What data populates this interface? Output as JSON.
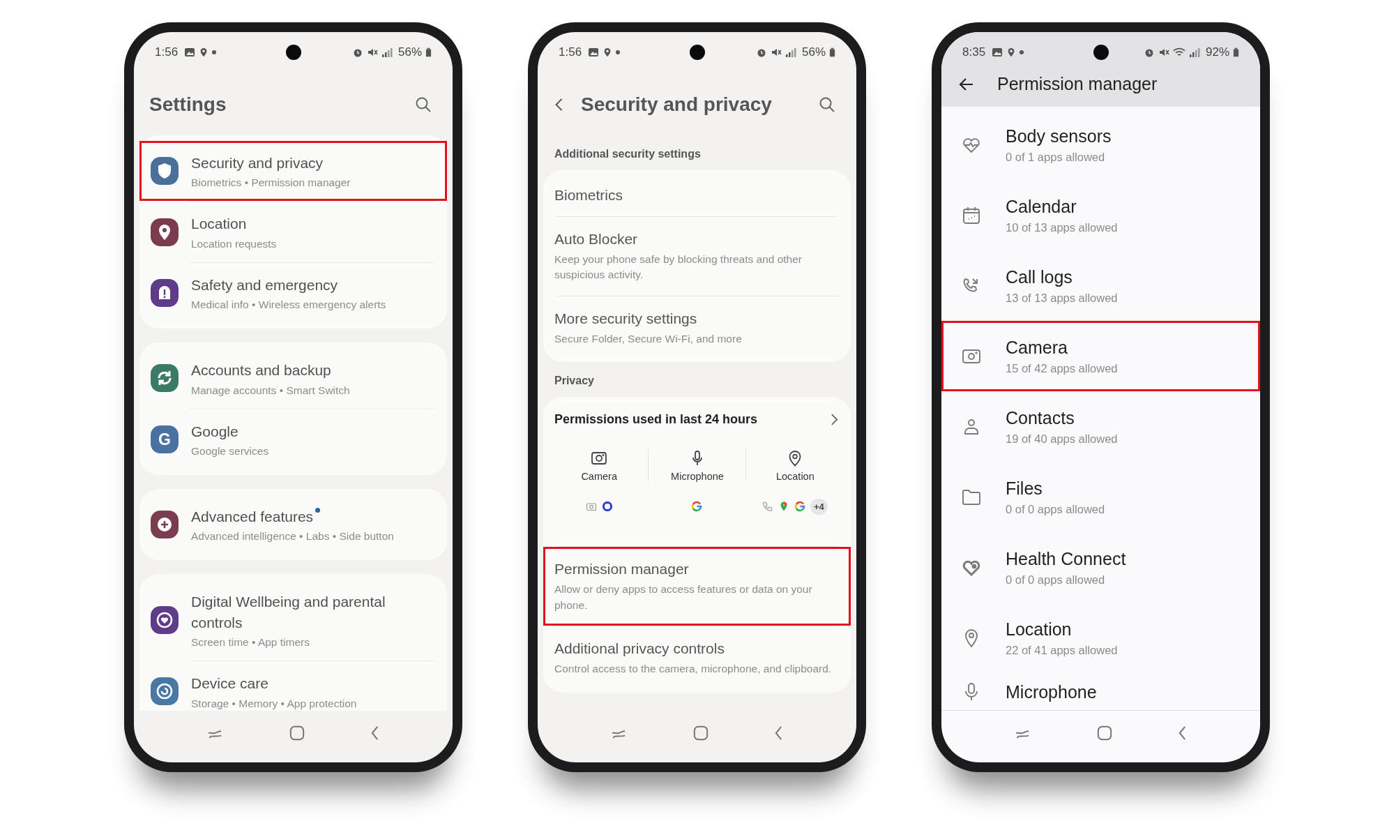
{
  "phones": [
    {
      "kind": "settings",
      "status_bar": {
        "time": "1:56",
        "battery": "56%"
      },
      "header": {
        "title": "Settings",
        "search": true
      },
      "groups": [
        {
          "items": [
            {
              "kind": "shield",
              "color": "#4a6f9a",
              "title": "Security and privacy",
              "subtitle": "Biometrics • Permission manager",
              "highlighted": true,
              "badge": false
            },
            {
              "kind": "pin",
              "color": "#7a3c4e",
              "title": "Location",
              "subtitle": "Location requests",
              "highlighted": false,
              "badge": false
            },
            {
              "kind": "alert",
              "color": "#5e3c8a",
              "title": "Safety and emergency",
              "subtitle": "Medical info • Wireless emergency alerts",
              "highlighted": false,
              "badge": false
            }
          ]
        },
        {
          "items": [
            {
              "kind": "sync",
              "color": "#3c7a68",
              "title": "Accounts and backup",
              "subtitle": "Manage accounts • Smart Switch",
              "highlighted": false,
              "badge": false
            },
            {
              "kind": "letter",
              "icon_text": "G",
              "color": "#4a72a0",
              "title": "Google",
              "subtitle": "Google services",
              "highlighted": false,
              "badge": false
            }
          ]
        },
        {
          "items": [
            {
              "kind": "gear",
              "color": "#7a3c4e",
              "title": "Advanced features",
              "subtitle": "Advanced intelligence • Labs • Side button",
              "highlighted": false,
              "badge": true
            }
          ]
        },
        {
          "items": [
            {
              "kind": "heart",
              "color": "#5e3c8a",
              "title": "Digital Wellbeing and parental controls",
              "subtitle": "Screen time • App timers",
              "highlighted": false,
              "badge": false
            },
            {
              "kind": "care",
              "color": "#4a78a5",
              "title": "Device care",
              "subtitle": "Storage • Memory • App protection",
              "highlighted": false,
              "badge": false
            }
          ]
        }
      ]
    },
    {
      "kind": "security",
      "status_bar": {
        "time": "1:56",
        "battery": "56%"
      },
      "header": {
        "title": "Security and privacy",
        "back": true,
        "search": true
      },
      "sections": [
        {
          "label": "Additional security settings",
          "items": [
            {
              "kind": "item",
              "title": "Biometrics",
              "highlighted": false
            },
            {
              "kind": "item",
              "title": "Auto Blocker",
              "subtitle": "Keep your phone safe by blocking threats and other suspicious activity.",
              "highlighted": false
            },
            {
              "kind": "item",
              "title": "More security settings",
              "subtitle": "Secure Folder, Secure Wi-Fi, and more",
              "highlighted": false
            }
          ]
        },
        {
          "label": "Privacy",
          "items": [
            {
              "kind": "usage",
              "title": "Permissions used in last 24 hours",
              "permissions": [
                {
                  "kind": "camera",
                  "label": "Camera",
                  "apps": [
                    {
                      "kind": "camera"
                    },
                    {
                      "kind": "ring"
                    }
                  ]
                },
                {
                  "kind": "mic",
                  "label": "Microphone",
                  "apps": [
                    {
                      "kind": "google"
                    }
                  ]
                },
                {
                  "kind": "pin",
                  "label": "Location",
                  "apps": [
                    {
                      "kind": "phone"
                    },
                    {
                      "kind": "maps"
                    },
                    {
                      "kind": "google"
                    }
                  ],
                  "more": "+4"
                }
              ]
            },
            {
              "kind": "item",
              "title": "Permission manager",
              "subtitle": "Allow or deny apps to access features or data on your phone.",
              "highlighted": true
            },
            {
              "kind": "item",
              "title": "Additional privacy controls",
              "subtitle": "Control access to the camera, microphone, and clipboard.",
              "highlighted": false
            }
          ]
        }
      ]
    },
    {
      "kind": "permissions",
      "status_bar": {
        "time": "8:35",
        "battery": "92%",
        "wifi": true
      },
      "header": {
        "title": "Permission manager",
        "back": true
      },
      "items": [
        {
          "kind": "pulse",
          "title": "Body sensors",
          "subtitle": "0 of 1 apps allowed",
          "highlighted": false
        },
        {
          "kind": "calendar",
          "title": "Calendar",
          "subtitle": "10 of 13 apps allowed",
          "highlighted": false
        },
        {
          "kind": "calls",
          "title": "Call logs",
          "subtitle": "13 of 13 apps allowed",
          "highlighted": false
        },
        {
          "kind": "camera",
          "title": "Camera",
          "subtitle": "15 of 42 apps allowed",
          "highlighted": true
        },
        {
          "kind": "person",
          "title": "Contacts",
          "subtitle": "19 of 40 apps allowed",
          "highlighted": false
        },
        {
          "kind": "folder",
          "title": "Files",
          "subtitle": "0 of 0 apps allowed",
          "highlighted": false
        },
        {
          "kind": "health",
          "title": "Health Connect",
          "subtitle": "0 of 0 apps allowed",
          "highlighted": false
        },
        {
          "kind": "pin",
          "title": "Location",
          "subtitle": "22 of 41 apps allowed",
          "highlighted": false
        },
        {
          "kind": "mic",
          "title": "Microphone",
          "highlighted": false
        }
      ]
    }
  ]
}
